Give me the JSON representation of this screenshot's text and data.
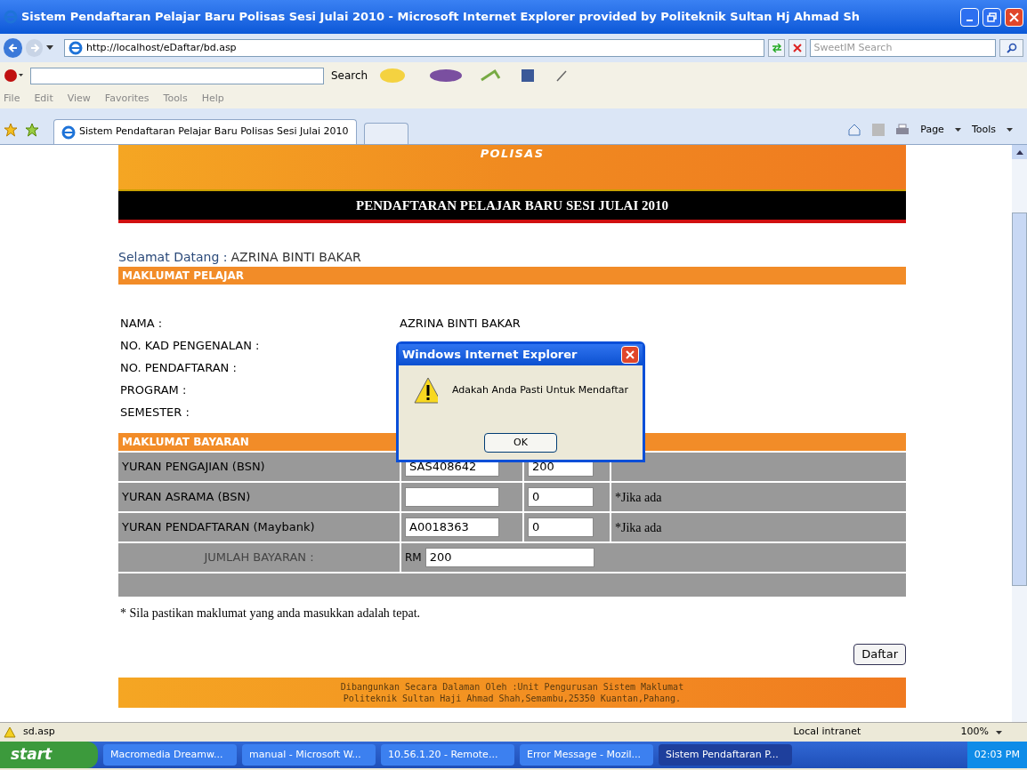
{
  "window": {
    "title": "Sistem Pendaftaran Pelajar Baru Polisas Sesi Julai 2010 - Microsoft Internet Explorer provided by Politeknik Sultan Hj Ahmad Sh"
  },
  "address_bar": {
    "url": "http://localhost/eDaftar/bd.asp",
    "search_placeholder": "SweetIM Search"
  },
  "toolbar": {
    "search_label": "Search"
  },
  "menu": [
    "File",
    "Edit",
    "View",
    "Favorites",
    "Tools",
    "Help"
  ],
  "tabs": [
    {
      "label": "Sistem Pendaftaran Pelajar Baru Polisas Sesi Julai 2010",
      "selected": true
    }
  ],
  "command_bar": {
    "page": "Page",
    "tools": "Tools"
  },
  "page": {
    "banner_logo": "POLISAS",
    "banner_title": "PENDAFTARAN PELAJAR BARU SESI JULAI 2010",
    "welcome_label": "Selamat Datang :",
    "welcome_name": "AZRINA BINTI BAKAR",
    "student_section": "MAKLUMAT PELAJAR",
    "student_fields": [
      {
        "label": "NAMA :",
        "value": "AZRINA BINTI BAKAR"
      },
      {
        "label": "NO. KAD PENGENALAN :"
      },
      {
        "label": "NO. PENDAFTARAN :"
      },
      {
        "label": "PROGRAM :"
      },
      {
        "label": "SEMESTER :"
      }
    ],
    "payment_section": "MAKLUMAT BAYARAN",
    "payments": [
      {
        "label": "YURAN PENGAJIAN (BSN)",
        "reference": "SAS408642",
        "amount": "200"
      },
      {
        "label": "YURAN ASRAMA (BSN)",
        "amount": "0",
        "note": "*Jika ada"
      },
      {
        "label": "YURAN PENDAFTARAN (Maybank)",
        "reference": "A0018363",
        "amount": "0",
        "note": "*Jika ada"
      }
    ],
    "total_label": "JUMLAH BAYARAN :",
    "total_currency": "RM",
    "total_value": "200",
    "notice": "* Sila pastikan maklumat yang anda masukkan adalah tepat.",
    "submit": "Daftar",
    "footer": [
      "Dibangunkan Secara Dalaman Oleh :Unit Pengurusan Sistem Maklumat",
      "Politeknik Sultan Haji Ahmad Shah,Semambu,25350 Kuantan,Pahang."
    ]
  },
  "dialog": {
    "title": "Windows Internet Explorer",
    "message": "Adakah Anda Pasti Untuk Mendaftar",
    "button": "OK"
  },
  "status_bar": {
    "text": "sd.asp",
    "zone": "Local intranet",
    "zoom": "100%"
  },
  "taskbar": {
    "start": "start",
    "items": [
      {
        "label": "Macromedia Dreamw...",
        "selected": false
      },
      {
        "label": "manual - Microsoft W...",
        "selected": false
      },
      {
        "label": "10.56.1.20 - Remote...",
        "selected": false
      },
      {
        "label": "Error Message - Mozil...",
        "selected": false
      },
      {
        "label": "Sistem Pendaftaran P...",
        "selected": true
      }
    ],
    "clock": "02:03 PM"
  }
}
